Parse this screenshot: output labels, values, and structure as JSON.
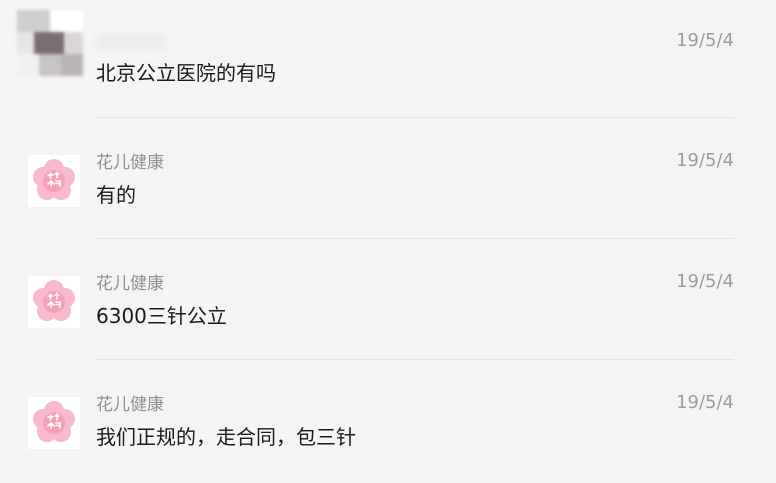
{
  "messages": [
    {
      "sender": "",
      "text": "北京公立医院的有吗",
      "time": "19/5/4",
      "avatar": "blurred-user-avatar"
    },
    {
      "sender": "花儿健康",
      "text": "有的",
      "time": "19/5/4",
      "avatar": "huaer-jiankang-logo"
    },
    {
      "sender": "花儿健康",
      "text": "6300三针公立",
      "time": "19/5/4",
      "avatar": "huaer-jiankang-logo"
    },
    {
      "sender": "花儿健康",
      "text": "我们正规的，走合同，包三针",
      "time": "19/5/4",
      "avatar": "huaer-jiankang-logo"
    }
  ],
  "colors": {
    "background": "#f4f4f5",
    "logo_pink": "#f3a1b8",
    "divider": "#e2e2e4"
  }
}
